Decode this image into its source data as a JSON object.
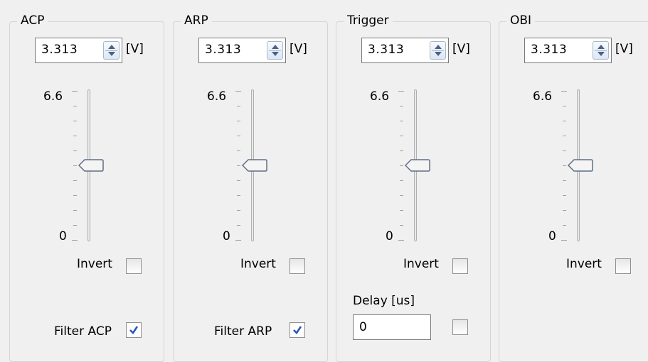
{
  "panels": [
    {
      "title": "ACP",
      "value": "3.313",
      "unit": "[V]",
      "max": "6.6",
      "min": "0",
      "level": 0.5,
      "invert_label": "Invert",
      "invert_checked": false,
      "filter_label": "Filter ACP",
      "filter_checked": true
    },
    {
      "title": "ARP",
      "value": "3.313",
      "unit": "[V]",
      "max": "6.6",
      "min": "0",
      "level": 0.5,
      "invert_label": "Invert",
      "invert_checked": false,
      "filter_label": "Filter ARP",
      "filter_checked": true
    },
    {
      "title": "Trigger",
      "value": "3.313",
      "unit": "[V]",
      "max": "6.6",
      "min": "0",
      "level": 0.5,
      "invert_label": "Invert",
      "invert_checked": false,
      "delay_label": "Delay [us]",
      "delay_value": "0",
      "delay_checked": false
    },
    {
      "title": "OBI",
      "value": "3.313",
      "unit": "[V]",
      "max": "6.6",
      "min": "0",
      "level": 0.5,
      "invert_label": "Invert",
      "invert_checked": false
    }
  ],
  "colors": {
    "check": "#2a56b8",
    "thumb_border": "#5f6f84"
  },
  "icons": {
    "spin": "spin-arrows-icon",
    "check": "checkmark-icon"
  }
}
